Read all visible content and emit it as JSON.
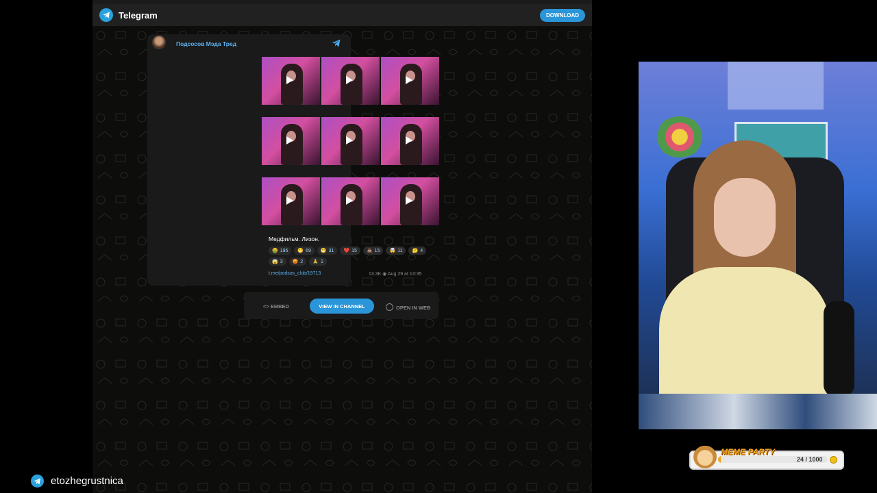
{
  "telegram": {
    "title": "Telegram",
    "download_label": "DOWNLOAD",
    "channel_name": "Подсосов Мэда Тред",
    "caption": "Медфильм. Лизон.",
    "reactions": [
      {
        "emoji": "🤮",
        "count": "195"
      },
      {
        "emoji": "😁",
        "count": "69"
      },
      {
        "emoji": "😁",
        "count": "31"
      },
      {
        "emoji": "❤️",
        "count": "15"
      },
      {
        "emoji": "💩",
        "count": "15"
      },
      {
        "emoji": "🤯",
        "count": "11"
      },
      {
        "emoji": "🤔",
        "count": "4"
      },
      {
        "emoji": "😱",
        "count": "3"
      },
      {
        "emoji": "😡",
        "count": "2"
      },
      {
        "emoji": "🙏",
        "count": "1"
      }
    ],
    "post_link": "t.me/podsos_club/19713",
    "views": "13.3K",
    "date": "Aug 29 at 13:35",
    "embed_label": "EMBED",
    "view_channel_label": "VIEW IN CHANNEL",
    "open_web_label": "OPEN IN WEB",
    "video_count": 9
  },
  "meme_party": {
    "title": "MEME PARTY",
    "count": "24 / 1000",
    "progress": 0.024
  },
  "stream_tag": {
    "icon": "telegram-icon",
    "name": "etozhegrustnica"
  },
  "colors": {
    "accent": "#2a95d8",
    "link": "#5fb2f0",
    "meme": "#f3a51a"
  }
}
